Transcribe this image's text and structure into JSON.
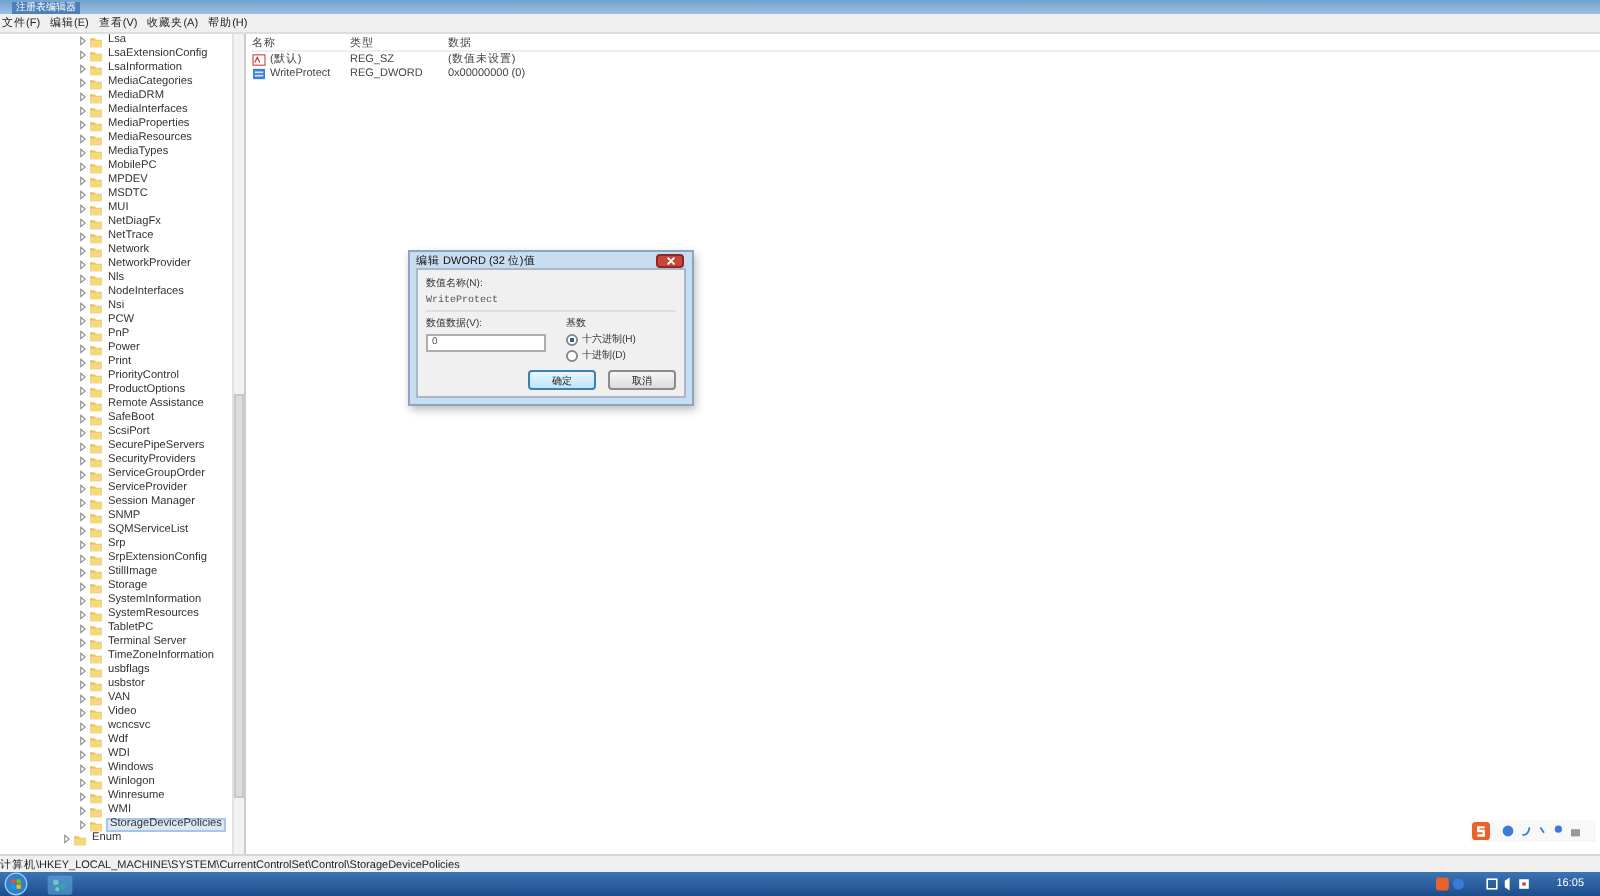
{
  "window": {
    "title": "注册表编辑器"
  },
  "menu": [
    "文件(F)",
    "编辑(E)",
    "查看(V)",
    "收藏夹(A)",
    "帮助(H)"
  ],
  "tree": {
    "children": [
      {
        "label": "Lsa",
        "selected": false
      },
      {
        "label": "LsaExtensionConfig",
        "selected": false
      },
      {
        "label": "LsaInformation",
        "selected": false
      },
      {
        "label": "MediaCategories",
        "selected": false
      },
      {
        "label": "MediaDRM",
        "selected": false
      },
      {
        "label": "MediaInterfaces",
        "selected": false
      },
      {
        "label": "MediaProperties",
        "selected": false
      },
      {
        "label": "MediaResources",
        "selected": false
      },
      {
        "label": "MediaTypes",
        "selected": false
      },
      {
        "label": "MobilePC",
        "selected": false
      },
      {
        "label": "MPDEV",
        "selected": false
      },
      {
        "label": "MSDTC",
        "selected": false
      },
      {
        "label": "MUI",
        "selected": false
      },
      {
        "label": "NetDiagFx",
        "selected": false
      },
      {
        "label": "NetTrace",
        "selected": false
      },
      {
        "label": "Network",
        "selected": false
      },
      {
        "label": "NetworkProvider",
        "selected": false
      },
      {
        "label": "Nls",
        "selected": false
      },
      {
        "label": "NodeInterfaces",
        "selected": false
      },
      {
        "label": "Nsi",
        "selected": false
      },
      {
        "label": "PCW",
        "selected": false
      },
      {
        "label": "PnP",
        "selected": false
      },
      {
        "label": "Power",
        "selected": false
      },
      {
        "label": "Print",
        "selected": false
      },
      {
        "label": "PriorityControl",
        "selected": false
      },
      {
        "label": "ProductOptions",
        "selected": false
      },
      {
        "label": "Remote Assistance",
        "selected": false
      },
      {
        "label": "SafeBoot",
        "selected": false
      },
      {
        "label": "ScsiPort",
        "selected": false
      },
      {
        "label": "SecurePipeServers",
        "selected": false
      },
      {
        "label": "SecurityProviders",
        "selected": false
      },
      {
        "label": "ServiceGroupOrder",
        "selected": false
      },
      {
        "label": "ServiceProvider",
        "selected": false
      },
      {
        "label": "Session Manager",
        "selected": false
      },
      {
        "label": "SNMP",
        "selected": false
      },
      {
        "label": "SQMServiceList",
        "selected": false
      },
      {
        "label": "Srp",
        "selected": false
      },
      {
        "label": "SrpExtensionConfig",
        "selected": false
      },
      {
        "label": "StillImage",
        "selected": false
      },
      {
        "label": "Storage",
        "selected": false
      },
      {
        "label": "SystemInformation",
        "selected": false
      },
      {
        "label": "SystemResources",
        "selected": false
      },
      {
        "label": "TabletPC",
        "selected": false
      },
      {
        "label": "Terminal Server",
        "selected": false
      },
      {
        "label": "TimeZoneInformation",
        "selected": false
      },
      {
        "label": "usbflags",
        "selected": false
      },
      {
        "label": "usbstor",
        "selected": false
      },
      {
        "label": "VAN",
        "selected": false
      },
      {
        "label": "Video",
        "selected": false
      },
      {
        "label": "wcncsvc",
        "selected": false
      },
      {
        "label": "Wdf",
        "selected": false
      },
      {
        "label": "WDI",
        "selected": false
      },
      {
        "label": "Windows",
        "selected": false
      },
      {
        "label": "Winlogon",
        "selected": false
      },
      {
        "label": "Winresume",
        "selected": false
      },
      {
        "label": "WMI",
        "selected": false
      },
      {
        "label": "StorageDevicePolicies",
        "selected": true
      }
    ],
    "next_siblings": [
      {
        "label": "Enum",
        "selected": false
      }
    ]
  },
  "values": {
    "columns": [
      "名称",
      "类型",
      "数据"
    ],
    "rows": [
      {
        "kind": "string",
        "name": "(默认)",
        "type": "REG_SZ",
        "data": "(数值未设置)",
        "selected": false
      },
      {
        "kind": "binary",
        "name": "WriteProtect",
        "type": "REG_DWORD",
        "data": "0x00000000 (0)",
        "selected": false
      }
    ]
  },
  "dialog": {
    "title": "编辑 DWORD (32 位)值",
    "name_label": "数值名称(N):",
    "name_value": "WriteProtect",
    "data_label": "数值数据(V):",
    "data_value": "0",
    "base_label": "基数",
    "bases": [
      {
        "label": "十六进制(H)",
        "selected": true
      },
      {
        "label": "十进制(D)",
        "selected": false
      }
    ],
    "buttons": [
      {
        "label": "确定",
        "default": true
      },
      {
        "label": "取消",
        "default": false
      }
    ]
  },
  "status_bar": "计算机\\HKEY_LOCAL_MACHINE\\SYSTEM\\CurrentControlSet\\Control\\StorageDevicePolicies",
  "taskbar": {
    "clock": "16:05"
  }
}
